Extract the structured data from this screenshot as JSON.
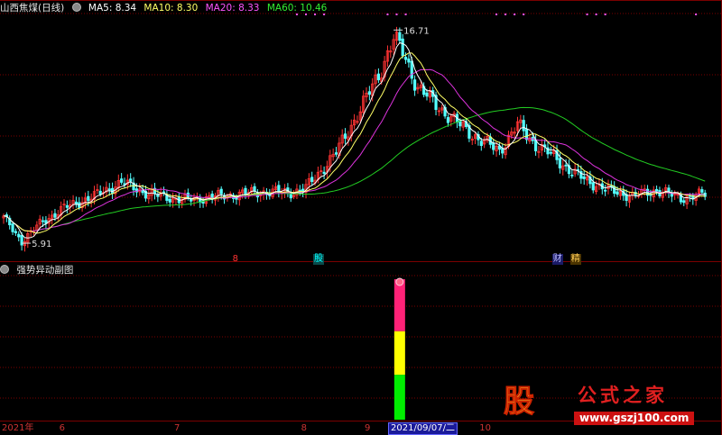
{
  "header": {
    "stock": "山西焦煤(日线)",
    "indicators": [
      {
        "label": "MA5: 8.34",
        "color": "#ffffff"
      },
      {
        "label": "MA10: 8.30",
        "color": "#ffff66"
      },
      {
        "label": "MA20: 8.33",
        "color": "#ff55ff"
      },
      {
        "label": "MA60: 10.46",
        "color": "#33ee33"
      }
    ]
  },
  "sub_panel": {
    "title": "强势异动副图"
  },
  "x_axis": {
    "ticks": [
      {
        "label": "2021年",
        "idx": 0
      },
      {
        "label": "6",
        "idx": 19
      },
      {
        "label": "7",
        "idx": 57
      },
      {
        "label": "8",
        "idx": 99
      },
      {
        "label": "9",
        "idx": 120
      },
      {
        "label": "10",
        "idx": 158
      }
    ],
    "current_date": "2021/09/07/二"
  },
  "events": [
    {
      "label": "8",
      "idx": 76,
      "color": "#ff3333",
      "bg": "none"
    },
    {
      "label": "股",
      "idx": 103,
      "color": "#00ffff",
      "bg": "#0a4a4a"
    },
    {
      "label": "财",
      "idx": 182,
      "color": "#bbbbff",
      "bg": "#1a1a66"
    },
    {
      "label": "精",
      "idx": 188,
      "color": "#ffcc55",
      "bg": "#4a3300"
    }
  ],
  "annotations": {
    "high": "16.71",
    "low": "5.91"
  },
  "watermark": {
    "logo": "股",
    "title": "公式之家",
    "url": "www.gszj100.com"
  },
  "colors": {
    "up": "#ff3333",
    "down": "#54ffff",
    "ma5": "#ffffff",
    "ma10": "#ffff66",
    "ma20": "#dd33dd",
    "ma60": "#22cc22",
    "grid": "#7a0000",
    "signal_top": "#ff2277",
    "signal_mid": "#ffff00",
    "signal_bottom": "#00ee00"
  },
  "chart_data": {
    "type": "candlestick",
    "y_range": [
      5.0,
      17.5
    ],
    "highest": 16.71,
    "lowest": 5.91,
    "anchors": [
      [
        0,
        7.2
      ],
      [
        6,
        6.0
      ],
      [
        12,
        6.9
      ],
      [
        20,
        7.7
      ],
      [
        30,
        8.3
      ],
      [
        39,
        9.0
      ],
      [
        48,
        8.4
      ],
      [
        60,
        8.1
      ],
      [
        72,
        8.3
      ],
      [
        84,
        8.5
      ],
      [
        96,
        8.5
      ],
      [
        100,
        8.7
      ],
      [
        110,
        10.5
      ],
      [
        118,
        12.7
      ],
      [
        124,
        14.4
      ],
      [
        129,
        16.3
      ],
      [
        132,
        15.6
      ],
      [
        137,
        13.8
      ],
      [
        144,
        12.8
      ],
      [
        150,
        12.0
      ],
      [
        158,
        11.1
      ],
      [
        164,
        10.6
      ],
      [
        170,
        11.9
      ],
      [
        176,
        10.9
      ],
      [
        182,
        10.3
      ],
      [
        188,
        9.5
      ],
      [
        194,
        9.0
      ],
      [
        200,
        8.6
      ],
      [
        208,
        8.3
      ],
      [
        216,
        8.6
      ],
      [
        224,
        8.2
      ],
      [
        232,
        8.4
      ]
    ],
    "signal": {
      "idx": 131,
      "bands": [
        {
          "color": "#00ee00",
          "value": 0.32
        },
        {
          "color": "#ffff00",
          "value": 0.31
        },
        {
          "color": "#ff2277",
          "value": 0.37
        }
      ]
    }
  }
}
